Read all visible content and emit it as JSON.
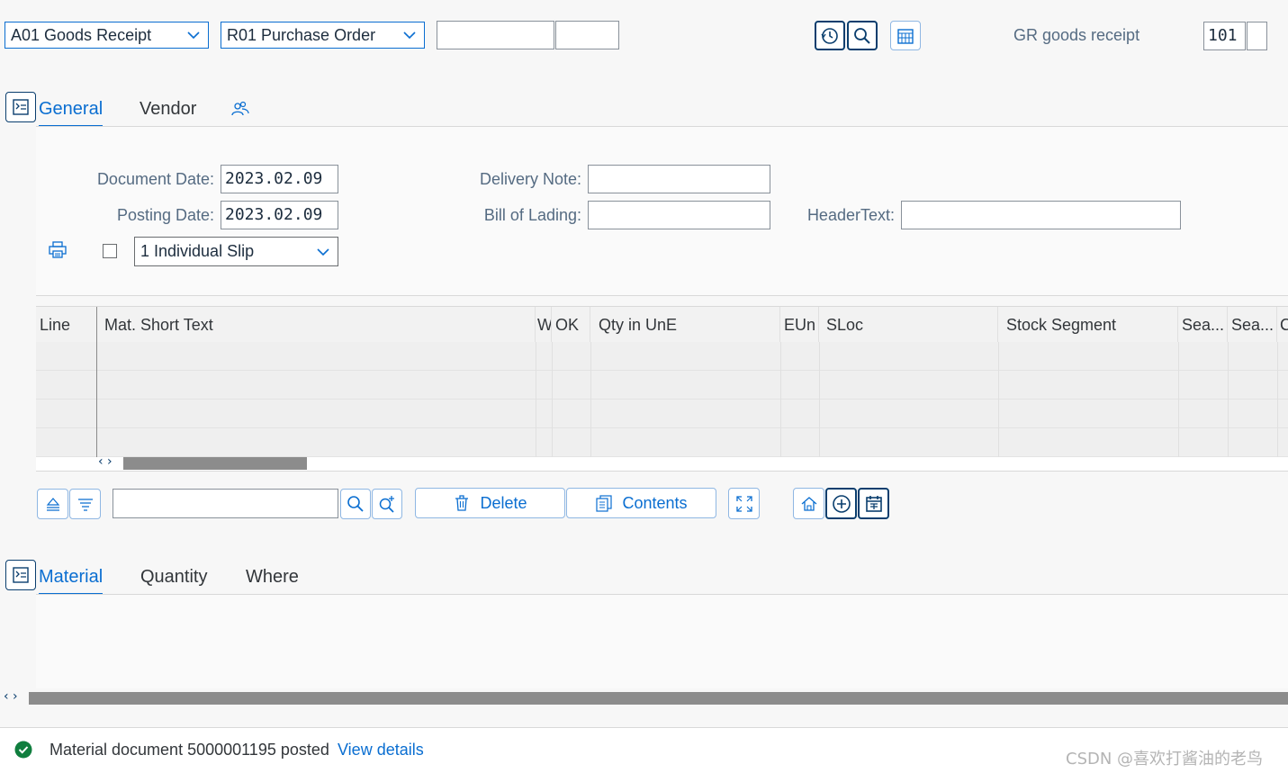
{
  "toolbar": {
    "transaction_select": "A01 Goods Receipt",
    "reference_select": "R01 Purchase Order",
    "ref_field1": "",
    "ref_field2": "",
    "movement_label": "GR goods receipt",
    "movement_type": "101",
    "movement_extra": ""
  },
  "header_tabs": [
    {
      "label": "General",
      "active": true
    },
    {
      "label": "Vendor",
      "active": false
    }
  ],
  "general": {
    "document_date_label": "Document Date:",
    "document_date": "2023.02.09",
    "posting_date_label": "Posting Date:",
    "posting_date": "2023.02.09",
    "delivery_note_label": "Delivery Note:",
    "delivery_note": "",
    "bill_of_lading_label": "Bill of Lading:",
    "bill_of_lading": "",
    "header_text_label": "HeaderText:",
    "header_text": "",
    "slip_select": "1 Individual Slip",
    "print_checked": false
  },
  "table": {
    "columns": [
      "Line",
      "Mat. Short Text",
      "W",
      "OK",
      "Qty in UnE",
      "EUn",
      "SLoc",
      "Stock Segment",
      "Sea...",
      "Sea...",
      "C"
    ],
    "rows": 4
  },
  "actions": {
    "search_value": "",
    "delete_label": "Delete",
    "contents_label": "Contents"
  },
  "detail_tabs": [
    {
      "label": "Material",
      "active": true
    },
    {
      "label": "Quantity",
      "active": false
    },
    {
      "label": "Where",
      "active": false
    }
  ],
  "status": {
    "message": "Material document 5000001195 posted",
    "link": "View details",
    "type": "success",
    "success_color": "#107e3e"
  },
  "watermark": "CSDN @喜欢打酱油的老鸟",
  "colors": {
    "accent": "#0a6ed1",
    "dark_border": "#0a3e6e"
  }
}
